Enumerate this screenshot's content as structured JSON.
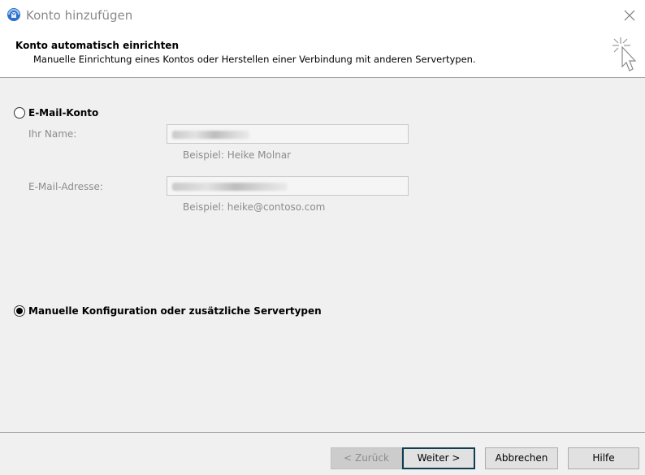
{
  "window": {
    "title": "Konto hinzufügen"
  },
  "header": {
    "title": "Konto automatisch einrichten",
    "subtitle": "Manuelle Einrichtung eines Kontos oder Herstellen einer Verbindung mit anderen Servertypen."
  },
  "email_account": {
    "label": "E-Mail-Konto",
    "selected": false,
    "name_label": "Ihr Name:",
    "name_hint": "Beispiel: Heike Molnar",
    "email_label": "E-Mail-Adresse:",
    "email_hint": "Beispiel: heike@contoso.com"
  },
  "manual_config": {
    "label": "Manuelle Konfiguration oder zusätzliche Servertypen",
    "selected": true
  },
  "buttons": {
    "back": "< Zurück",
    "next": "Weiter >",
    "cancel": "Abbrechen",
    "help": "Hilfe"
  },
  "colors": {
    "disabled_text": "#8c8c8c",
    "default_button_border": "#0f3e4e"
  }
}
